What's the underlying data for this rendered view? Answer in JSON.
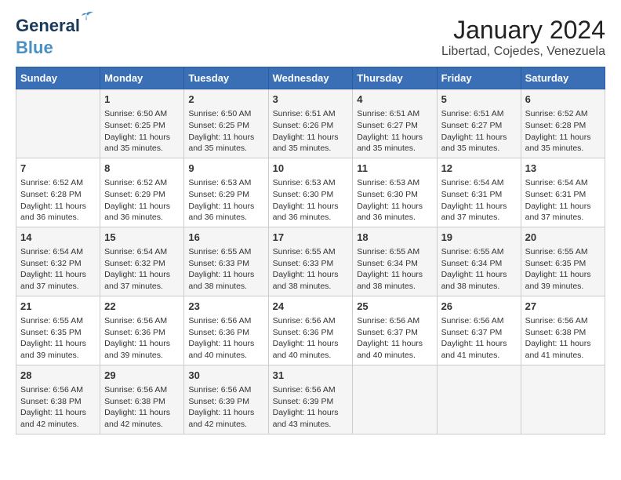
{
  "logo": {
    "line1": "General",
    "line2": "Blue"
  },
  "title": "January 2024",
  "subtitle": "Libertad, Cojedes, Venezuela",
  "headers": [
    "Sunday",
    "Monday",
    "Tuesday",
    "Wednesday",
    "Thursday",
    "Friday",
    "Saturday"
  ],
  "weeks": [
    [
      {
        "day": "",
        "sunrise": "",
        "sunset": "",
        "daylight": ""
      },
      {
        "day": "1",
        "sunrise": "Sunrise: 6:50 AM",
        "sunset": "Sunset: 6:25 PM",
        "daylight": "Daylight: 11 hours and 35 minutes."
      },
      {
        "day": "2",
        "sunrise": "Sunrise: 6:50 AM",
        "sunset": "Sunset: 6:25 PM",
        "daylight": "Daylight: 11 hours and 35 minutes."
      },
      {
        "day": "3",
        "sunrise": "Sunrise: 6:51 AM",
        "sunset": "Sunset: 6:26 PM",
        "daylight": "Daylight: 11 hours and 35 minutes."
      },
      {
        "day": "4",
        "sunrise": "Sunrise: 6:51 AM",
        "sunset": "Sunset: 6:27 PM",
        "daylight": "Daylight: 11 hours and 35 minutes."
      },
      {
        "day": "5",
        "sunrise": "Sunrise: 6:51 AM",
        "sunset": "Sunset: 6:27 PM",
        "daylight": "Daylight: 11 hours and 35 minutes."
      },
      {
        "day": "6",
        "sunrise": "Sunrise: 6:52 AM",
        "sunset": "Sunset: 6:28 PM",
        "daylight": "Daylight: 11 hours and 35 minutes."
      }
    ],
    [
      {
        "day": "7",
        "sunrise": "Sunrise: 6:52 AM",
        "sunset": "Sunset: 6:28 PM",
        "daylight": "Daylight: 11 hours and 36 minutes."
      },
      {
        "day": "8",
        "sunrise": "Sunrise: 6:52 AM",
        "sunset": "Sunset: 6:29 PM",
        "daylight": "Daylight: 11 hours and 36 minutes."
      },
      {
        "day": "9",
        "sunrise": "Sunrise: 6:53 AM",
        "sunset": "Sunset: 6:29 PM",
        "daylight": "Daylight: 11 hours and 36 minutes."
      },
      {
        "day": "10",
        "sunrise": "Sunrise: 6:53 AM",
        "sunset": "Sunset: 6:30 PM",
        "daylight": "Daylight: 11 hours and 36 minutes."
      },
      {
        "day": "11",
        "sunrise": "Sunrise: 6:53 AM",
        "sunset": "Sunset: 6:30 PM",
        "daylight": "Daylight: 11 hours and 36 minutes."
      },
      {
        "day": "12",
        "sunrise": "Sunrise: 6:54 AM",
        "sunset": "Sunset: 6:31 PM",
        "daylight": "Daylight: 11 hours and 37 minutes."
      },
      {
        "day": "13",
        "sunrise": "Sunrise: 6:54 AM",
        "sunset": "Sunset: 6:31 PM",
        "daylight": "Daylight: 11 hours and 37 minutes."
      }
    ],
    [
      {
        "day": "14",
        "sunrise": "Sunrise: 6:54 AM",
        "sunset": "Sunset: 6:32 PM",
        "daylight": "Daylight: 11 hours and 37 minutes."
      },
      {
        "day": "15",
        "sunrise": "Sunrise: 6:54 AM",
        "sunset": "Sunset: 6:32 PM",
        "daylight": "Daylight: 11 hours and 37 minutes."
      },
      {
        "day": "16",
        "sunrise": "Sunrise: 6:55 AM",
        "sunset": "Sunset: 6:33 PM",
        "daylight": "Daylight: 11 hours and 38 minutes."
      },
      {
        "day": "17",
        "sunrise": "Sunrise: 6:55 AM",
        "sunset": "Sunset: 6:33 PM",
        "daylight": "Daylight: 11 hours and 38 minutes."
      },
      {
        "day": "18",
        "sunrise": "Sunrise: 6:55 AM",
        "sunset": "Sunset: 6:34 PM",
        "daylight": "Daylight: 11 hours and 38 minutes."
      },
      {
        "day": "19",
        "sunrise": "Sunrise: 6:55 AM",
        "sunset": "Sunset: 6:34 PM",
        "daylight": "Daylight: 11 hours and 38 minutes."
      },
      {
        "day": "20",
        "sunrise": "Sunrise: 6:55 AM",
        "sunset": "Sunset: 6:35 PM",
        "daylight": "Daylight: 11 hours and 39 minutes."
      }
    ],
    [
      {
        "day": "21",
        "sunrise": "Sunrise: 6:55 AM",
        "sunset": "Sunset: 6:35 PM",
        "daylight": "Daylight: 11 hours and 39 minutes."
      },
      {
        "day": "22",
        "sunrise": "Sunrise: 6:56 AM",
        "sunset": "Sunset: 6:36 PM",
        "daylight": "Daylight: 11 hours and 39 minutes."
      },
      {
        "day": "23",
        "sunrise": "Sunrise: 6:56 AM",
        "sunset": "Sunset: 6:36 PM",
        "daylight": "Daylight: 11 hours and 40 minutes."
      },
      {
        "day": "24",
        "sunrise": "Sunrise: 6:56 AM",
        "sunset": "Sunset: 6:36 PM",
        "daylight": "Daylight: 11 hours and 40 minutes."
      },
      {
        "day": "25",
        "sunrise": "Sunrise: 6:56 AM",
        "sunset": "Sunset: 6:37 PM",
        "daylight": "Daylight: 11 hours and 40 minutes."
      },
      {
        "day": "26",
        "sunrise": "Sunrise: 6:56 AM",
        "sunset": "Sunset: 6:37 PM",
        "daylight": "Daylight: 11 hours and 41 minutes."
      },
      {
        "day": "27",
        "sunrise": "Sunrise: 6:56 AM",
        "sunset": "Sunset: 6:38 PM",
        "daylight": "Daylight: 11 hours and 41 minutes."
      }
    ],
    [
      {
        "day": "28",
        "sunrise": "Sunrise: 6:56 AM",
        "sunset": "Sunset: 6:38 PM",
        "daylight": "Daylight: 11 hours and 42 minutes."
      },
      {
        "day": "29",
        "sunrise": "Sunrise: 6:56 AM",
        "sunset": "Sunset: 6:38 PM",
        "daylight": "Daylight: 11 hours and 42 minutes."
      },
      {
        "day": "30",
        "sunrise": "Sunrise: 6:56 AM",
        "sunset": "Sunset: 6:39 PM",
        "daylight": "Daylight: 11 hours and 42 minutes."
      },
      {
        "day": "31",
        "sunrise": "Sunrise: 6:56 AM",
        "sunset": "Sunset: 6:39 PM",
        "daylight": "Daylight: 11 hours and 43 minutes."
      },
      {
        "day": "",
        "sunrise": "",
        "sunset": "",
        "daylight": ""
      },
      {
        "day": "",
        "sunrise": "",
        "sunset": "",
        "daylight": ""
      },
      {
        "day": "",
        "sunrise": "",
        "sunset": "",
        "daylight": ""
      }
    ]
  ]
}
